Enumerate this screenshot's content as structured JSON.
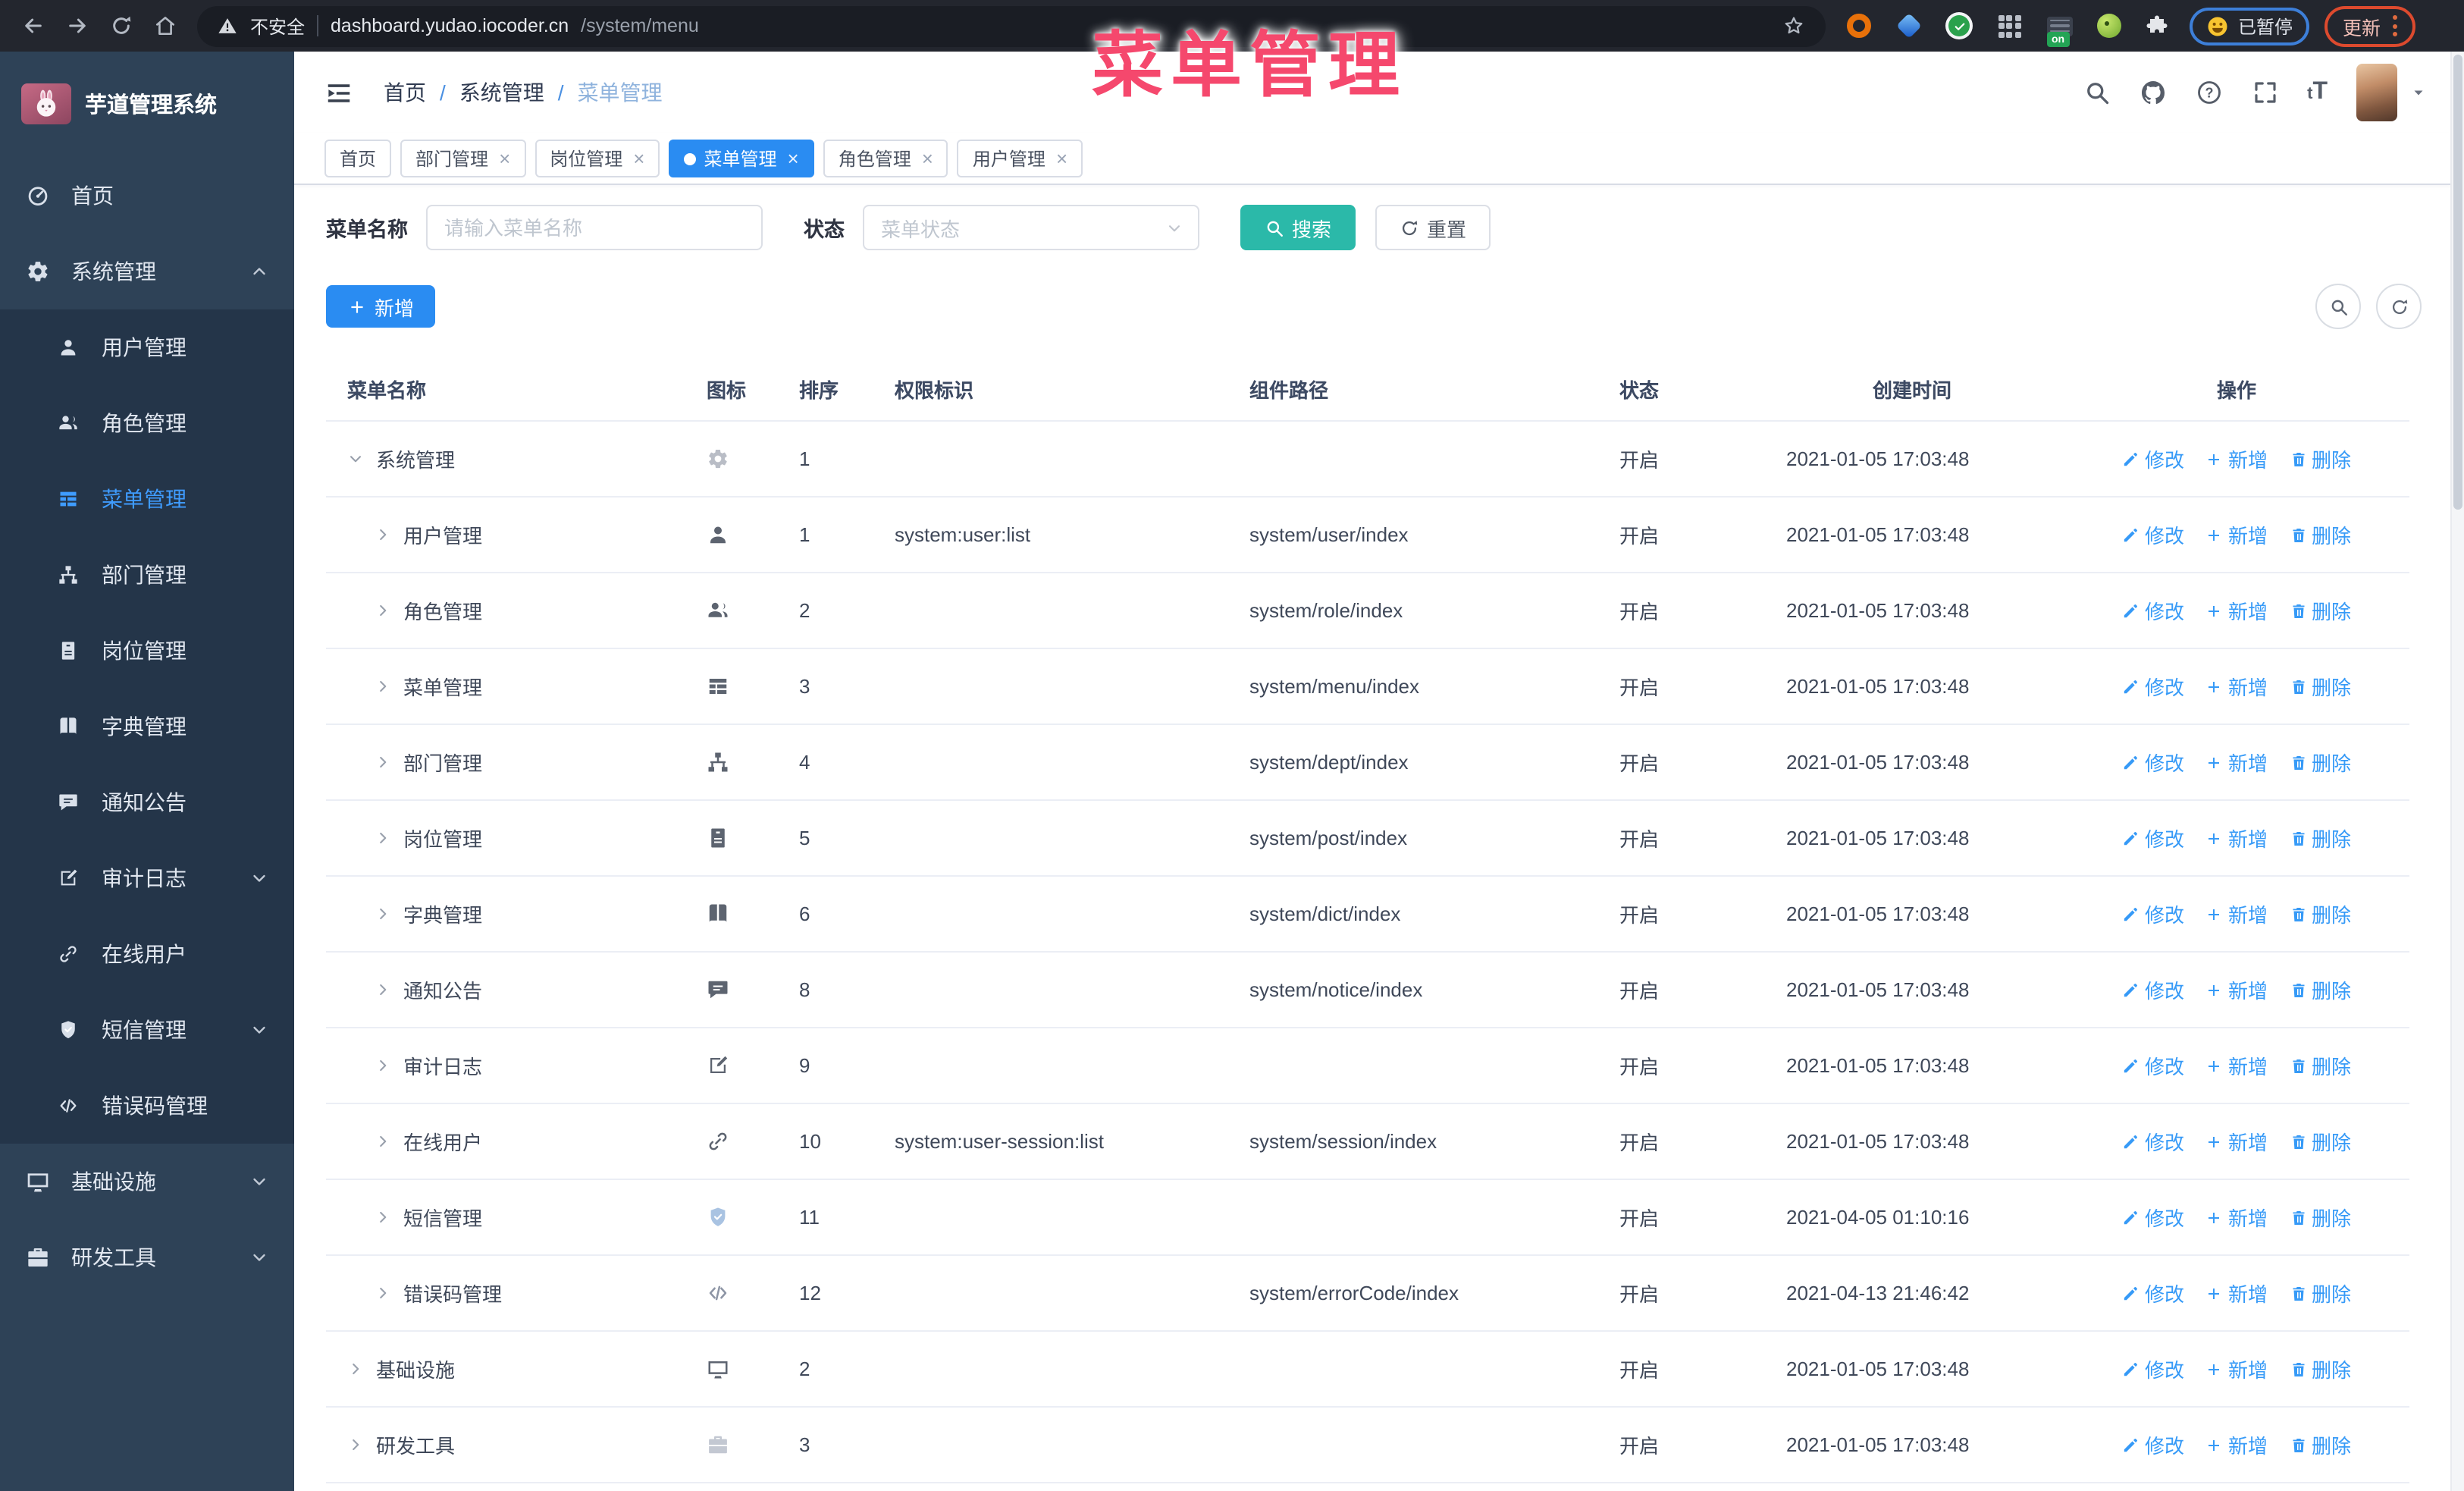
{
  "annotation": {
    "text": "菜单管理",
    "color": "#f5486d"
  },
  "browser": {
    "security_label": "不安全",
    "url_host": "dashboard.yudao.iocoder.cn",
    "url_path": "/system/menu",
    "paused_label": "已暂停",
    "update_label": "更新",
    "nav_icons": [
      "back-icon",
      "forward-icon",
      "reload-icon",
      "home-icon"
    ],
    "extension_icons": [
      "star-icon",
      "donut-icon",
      "gem-icon",
      "green-check-icon",
      "grid-icon",
      "dark-on-icon",
      "frog-icon",
      "puzzle-icon"
    ]
  },
  "colors": {
    "primary": "#2a8cf2",
    "teal": "#2bb9a9",
    "sidebar": "#2e4257",
    "sidebar_sub": "#243549",
    "annotation": "#f5486d",
    "link": "#369af7"
  },
  "sidebar": {
    "title": "芋道管理系统",
    "items": [
      {
        "label": "首页",
        "icon": "dashboard",
        "type": "top",
        "chevron": ""
      },
      {
        "label": "系统管理",
        "icon": "gear",
        "type": "top",
        "chevron": "up"
      },
      {
        "label": "用户管理",
        "icon": "user",
        "type": "sub",
        "chevron": ""
      },
      {
        "label": "角色管理",
        "icon": "users",
        "type": "sub",
        "chevron": ""
      },
      {
        "label": "菜单管理",
        "icon": "menu",
        "type": "sub",
        "chevron": "",
        "active": true
      },
      {
        "label": "部门管理",
        "icon": "tree",
        "type": "sub",
        "chevron": ""
      },
      {
        "label": "岗位管理",
        "icon": "badge",
        "type": "sub",
        "chevron": ""
      },
      {
        "label": "字典管理",
        "icon": "book",
        "type": "sub",
        "chevron": ""
      },
      {
        "label": "通知公告",
        "icon": "chat",
        "type": "sub",
        "chevron": ""
      },
      {
        "label": "审计日志",
        "icon": "edit",
        "type": "sub",
        "chevron": "down"
      },
      {
        "label": "在线用户",
        "icon": "link",
        "type": "sub",
        "chevron": ""
      },
      {
        "label": "短信管理",
        "icon": "shield",
        "type": "sub",
        "chevron": "down"
      },
      {
        "label": "错误码管理",
        "icon": "code",
        "type": "sub",
        "chevron": ""
      },
      {
        "label": "基础设施",
        "icon": "monitor",
        "type": "top",
        "chevron": "down"
      },
      {
        "label": "研发工具",
        "icon": "toolbox",
        "type": "top",
        "chevron": "down"
      }
    ]
  },
  "header": {
    "breadcrumb": [
      "首页",
      "系统管理",
      "菜单管理"
    ],
    "icons": [
      "search-icon",
      "github-icon",
      "help-icon",
      "fullscreen-icon",
      "font-size-icon",
      "avatar",
      "caret-down-icon"
    ]
  },
  "tabs": [
    {
      "label": "首页",
      "closable": false,
      "active": false
    },
    {
      "label": "部门管理",
      "closable": true,
      "active": false
    },
    {
      "label": "岗位管理",
      "closable": true,
      "active": false
    },
    {
      "label": "菜单管理",
      "closable": true,
      "active": true
    },
    {
      "label": "角色管理",
      "closable": true,
      "active": false
    },
    {
      "label": "用户管理",
      "closable": true,
      "active": false
    }
  ],
  "filters": {
    "name_label": "菜单名称",
    "name_placeholder": "请输入菜单名称",
    "name_value": "",
    "status_label": "状态",
    "status_placeholder": "菜单状态",
    "search_label": "搜索",
    "reset_label": "重置"
  },
  "toolbar": {
    "add_label": "新增"
  },
  "table": {
    "columns": [
      "菜单名称",
      "图标",
      "排序",
      "权限标识",
      "组件路径",
      "状态",
      "创建时间",
      "操作"
    ],
    "ops": [
      "修改",
      "新增",
      "删除"
    ],
    "rows": [
      {
        "name": "系统管理",
        "icon": "gear",
        "icon_color": "#b9bdc6",
        "arrow": "down",
        "level": 0,
        "sort": "1",
        "perm": "",
        "path": "",
        "status": "开启",
        "time": "2021-01-05 17:03:48"
      },
      {
        "name": "用户管理",
        "icon": "user",
        "icon_color": "",
        "arrow": "right",
        "level": 1,
        "sort": "1",
        "perm": "system:user:list",
        "path": "system/user/index",
        "status": "开启",
        "time": "2021-01-05 17:03:48"
      },
      {
        "name": "角色管理",
        "icon": "users",
        "icon_color": "",
        "arrow": "right",
        "level": 1,
        "sort": "2",
        "perm": "",
        "path": "system/role/index",
        "status": "开启",
        "time": "2021-01-05 17:03:48"
      },
      {
        "name": "菜单管理",
        "icon": "menu",
        "icon_color": "",
        "arrow": "right",
        "level": 1,
        "sort": "3",
        "perm": "",
        "path": "system/menu/index",
        "status": "开启",
        "time": "2021-01-05 17:03:48"
      },
      {
        "name": "部门管理",
        "icon": "tree",
        "icon_color": "",
        "arrow": "right",
        "level": 1,
        "sort": "4",
        "perm": "",
        "path": "system/dept/index",
        "status": "开启",
        "time": "2021-01-05 17:03:48"
      },
      {
        "name": "岗位管理",
        "icon": "badge",
        "icon_color": "",
        "arrow": "right",
        "level": 1,
        "sort": "5",
        "perm": "",
        "path": "system/post/index",
        "status": "开启",
        "time": "2021-01-05 17:03:48"
      },
      {
        "name": "字典管理",
        "icon": "book",
        "icon_color": "",
        "arrow": "right",
        "level": 1,
        "sort": "6",
        "perm": "",
        "path": "system/dict/index",
        "status": "开启",
        "time": "2021-01-05 17:03:48"
      },
      {
        "name": "通知公告",
        "icon": "chat",
        "icon_color": "",
        "arrow": "right",
        "level": 1,
        "sort": "8",
        "perm": "",
        "path": "system/notice/index",
        "status": "开启",
        "time": "2021-01-05 17:03:48"
      },
      {
        "name": "审计日志",
        "icon": "edit",
        "icon_color": "",
        "arrow": "right",
        "level": 1,
        "sort": "9",
        "perm": "",
        "path": "",
        "status": "开启",
        "time": "2021-01-05 17:03:48"
      },
      {
        "name": "在线用户",
        "icon": "link",
        "icon_color": "",
        "arrow": "right",
        "level": 1,
        "sort": "10",
        "perm": "system:user-session:list",
        "path": "system/session/index",
        "status": "开启",
        "time": "2021-01-05 17:03:48"
      },
      {
        "name": "短信管理",
        "icon": "shield",
        "icon_color": "#a9c3e2",
        "arrow": "right",
        "level": 1,
        "sort": "11",
        "perm": "",
        "path": "",
        "status": "开启",
        "time": "2021-04-05 01:10:16"
      },
      {
        "name": "错误码管理",
        "icon": "code",
        "icon_color": "#8d95a5",
        "arrow": "right",
        "level": 1,
        "sort": "12",
        "perm": "",
        "path": "system/errorCode/index",
        "status": "开启",
        "time": "2021-04-13 21:46:42"
      },
      {
        "name": "基础设施",
        "icon": "monitor",
        "icon_color": "",
        "arrow": "right",
        "level": 0,
        "sort": "2",
        "perm": "",
        "path": "",
        "status": "开启",
        "time": "2021-01-05 17:03:48"
      },
      {
        "name": "研发工具",
        "icon": "toolbox",
        "icon_color": "#c3c8d2",
        "arrow": "right",
        "level": 0,
        "sort": "3",
        "perm": "",
        "path": "",
        "status": "开启",
        "time": "2021-01-05 17:03:48"
      }
    ]
  }
}
